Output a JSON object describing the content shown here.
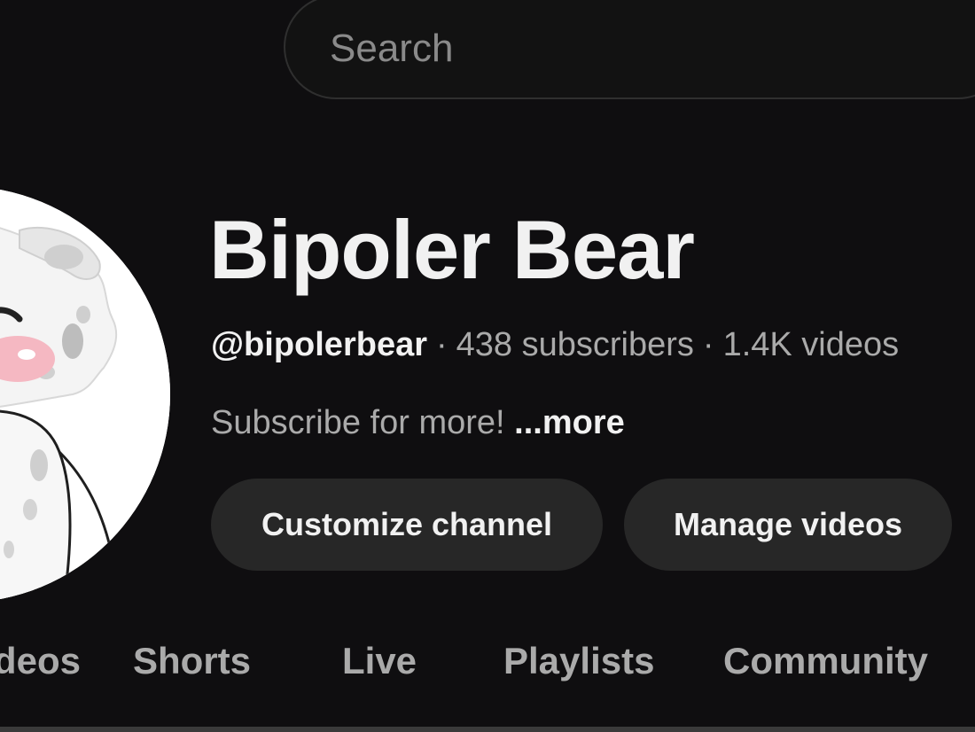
{
  "header": {
    "search_placeholder": "Search"
  },
  "channel": {
    "name": "Bipoler Bear",
    "handle": "@bipolerbear",
    "subscribers": "438 subscribers",
    "videos": "1.4K videos",
    "separator": "·",
    "description": "Subscribe for more!",
    "more_label": "...more"
  },
  "actions": {
    "customize_label": "Customize channel",
    "manage_label": "Manage videos"
  },
  "tabs": [
    {
      "label": "Videos"
    },
    {
      "label": "Shorts"
    },
    {
      "label": "Live"
    },
    {
      "label": "Playlists"
    },
    {
      "label": "Community"
    }
  ],
  "colors": {
    "background": "#0f0e10",
    "button_bg": "#272727",
    "text_primary": "#f1f1f1",
    "text_secondary": "#aaaaaa"
  }
}
